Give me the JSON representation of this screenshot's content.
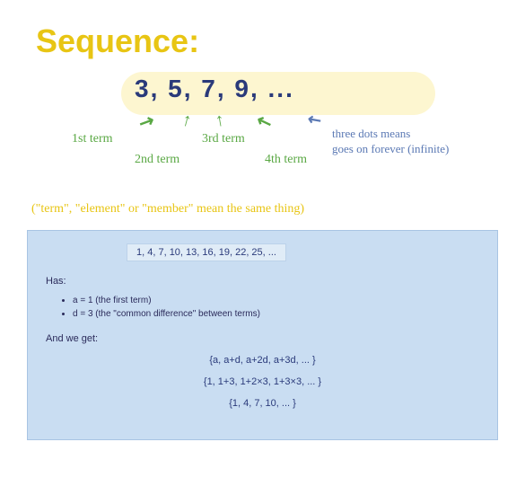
{
  "title": "Sequence:",
  "diagram": {
    "sequence_text": "3, 5, 7, 9, ...",
    "terms": {
      "t1": "1st term",
      "t2": "2nd term",
      "t3": "3rd term",
      "t4": "4th term"
    },
    "infinite_note": "three dots means\ngoes on forever (infinite)"
  },
  "synonym_note": "(\"term\", \"element\" or \"member\" mean the same thing)",
  "bluebox": {
    "example_sequence": "1, 4, 7, 10, 13, 16, 19, 22, 25, ...",
    "has_label": "Has:",
    "bullets": {
      "a": "a = 1 (the first term)",
      "d": "d = 3 (the \"common difference\" between terms)"
    },
    "and_we_get": "And we get:",
    "formulas": {
      "f1": "{a, a+d, a+2d, a+3d, ... }",
      "f2": "{1, 1+3, 1+2×3, 1+3×3, ... }",
      "f3": "{1, 4, 7, 10, ... }"
    }
  }
}
